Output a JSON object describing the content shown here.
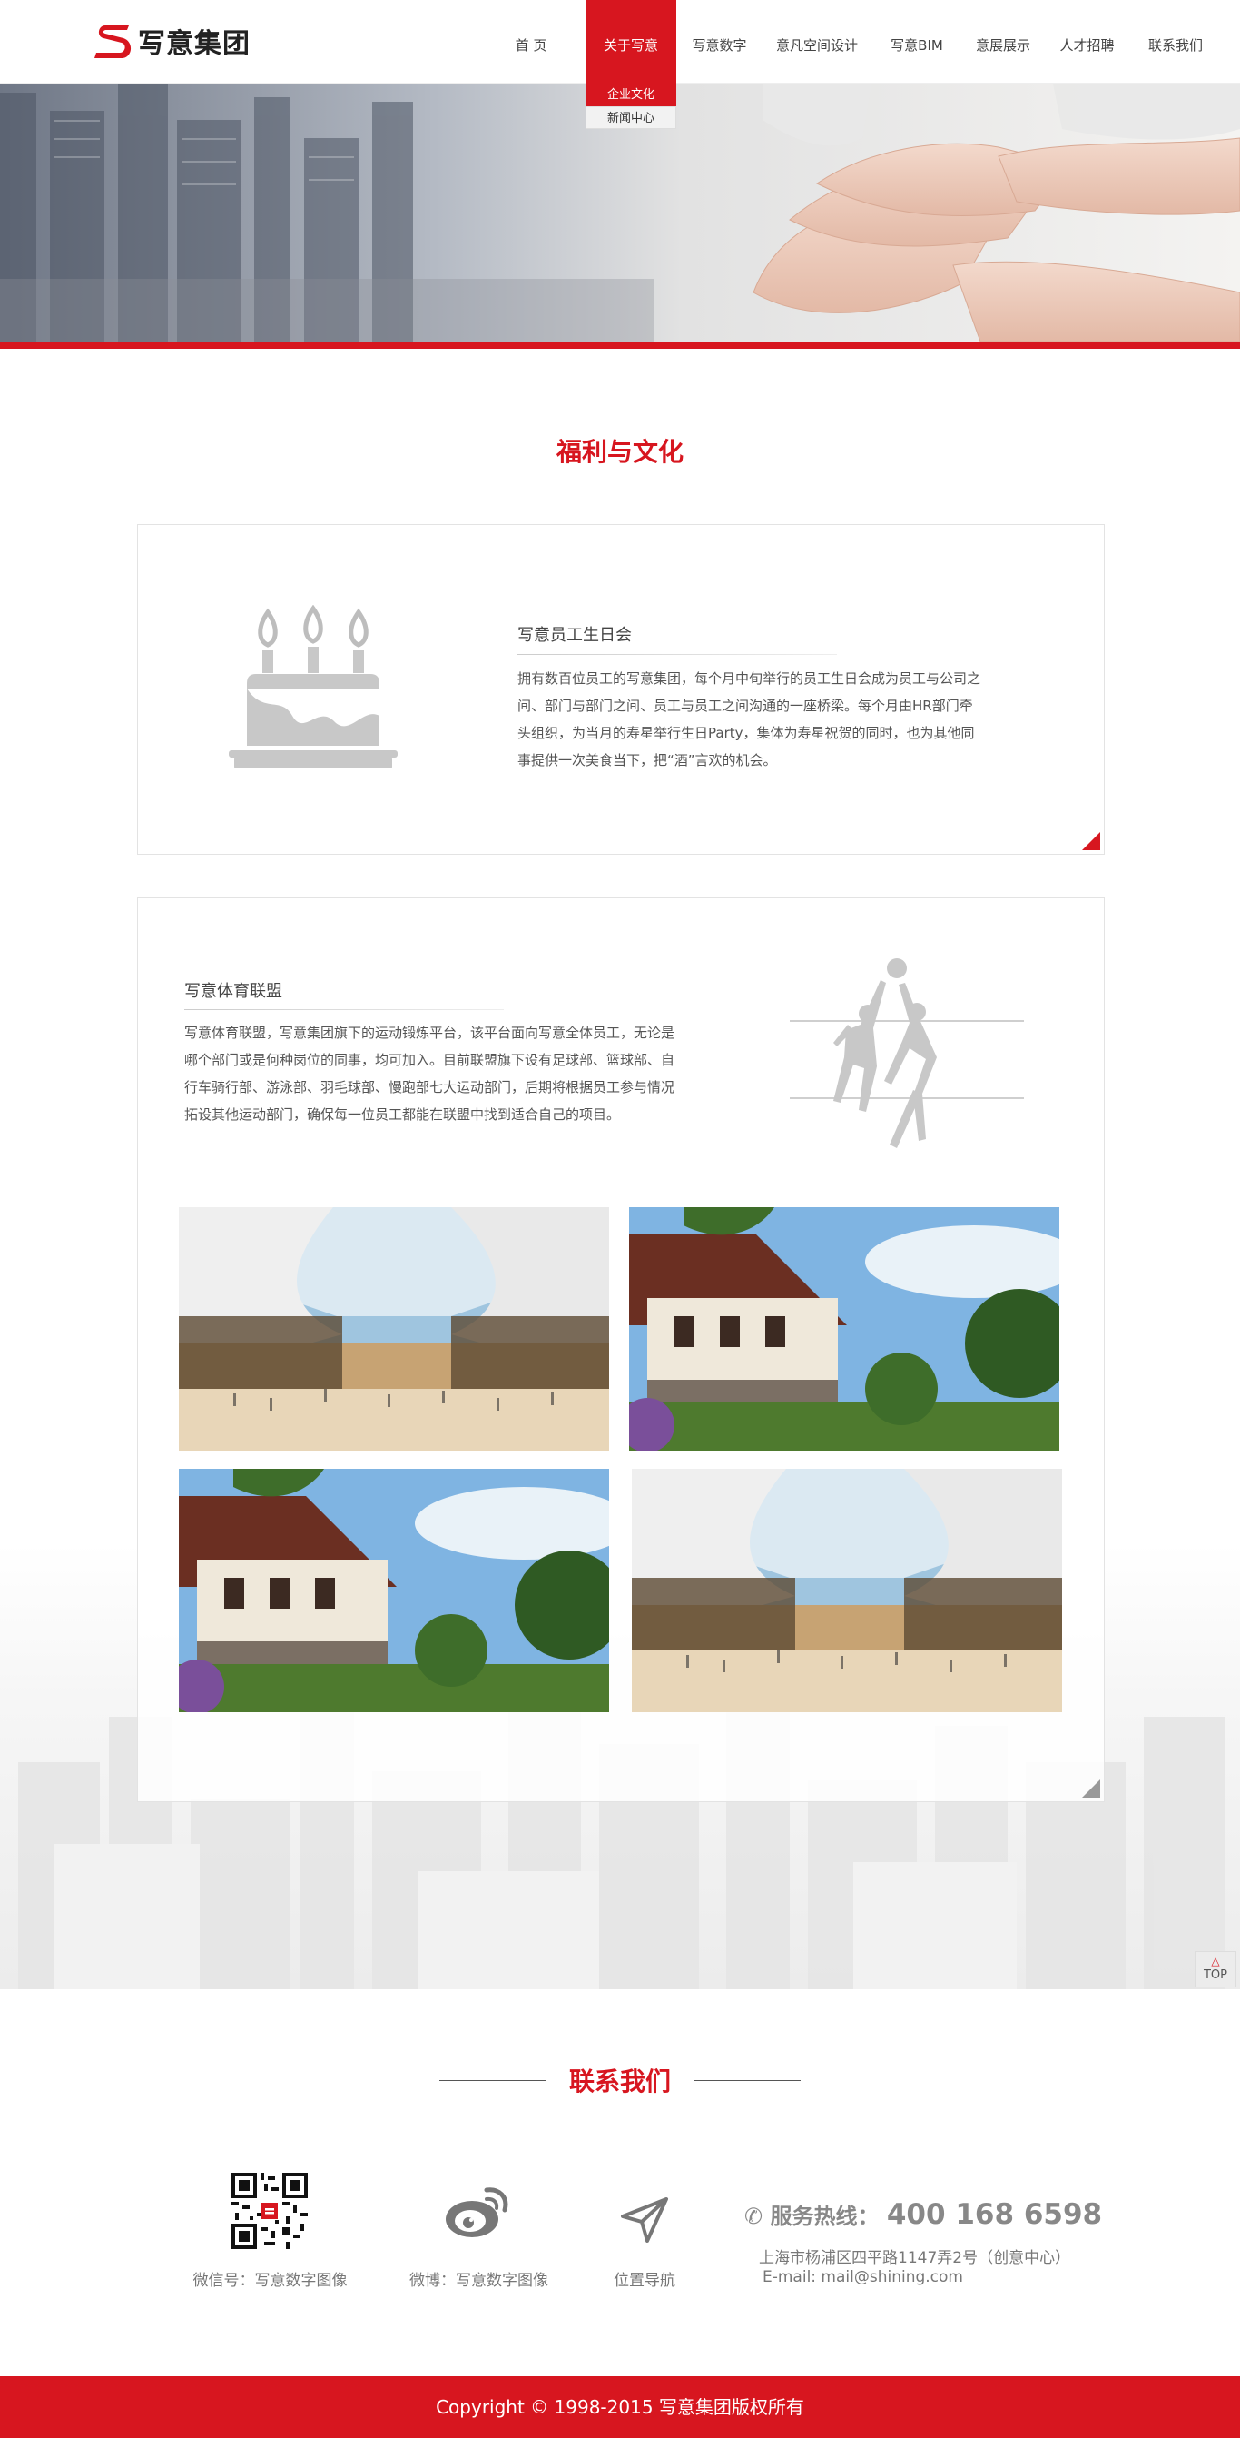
{
  "header": {
    "logo_text": "写意集团",
    "nav": [
      {
        "label": "首 页"
      },
      {
        "label": "关于写意"
      },
      {
        "label": "写意数字"
      },
      {
        "label": "意凡空间设计"
      },
      {
        "label": "写意BIM"
      },
      {
        "label": "意展展示"
      },
      {
        "label": "人才招聘"
      },
      {
        "label": "联系我们"
      }
    ],
    "submenu": [
      "企业文化",
      "新闻中心"
    ]
  },
  "colors": {
    "accent": "#d7161f",
    "text": "#555555",
    "icon_gray": "#c8c8c8"
  },
  "section1": {
    "title": "福利与文化"
  },
  "birthday": {
    "icon": "birthday-cake-icon",
    "heading": "写意员工生日会",
    "lines": [
      "拥有数百位员工的写意集团，每个月中旬举行的员工生日会成为员工与公司之",
      "间、部门与部门之间、员工与员工之间沟通的一座桥梁。每个月由HR部门牵",
      "头组织，为当月的寿星举行生日Party，集体为寿星祝贺的同时，也为其他同",
      "事提供一次美食当下，把“酒”言欢的机会。"
    ]
  },
  "sports": {
    "icon": "volleyball-players-icon",
    "heading": "写意体育联盟",
    "lines": [
      "写意体育联盟，写意集团旗下的运动锻炼平台，该平台面向写意全体员工，无论是",
      "哪个部门或是何种岗位的同事，均可加入。目前联盟旗下设有足球部、篮球部、自",
      "行车骑行部、游泳部、羽毛球部、慢跑部七大运动部门，后期将根据员工参与情况",
      "拓设其他运动部门，确保每一位员工都能在联盟中找到适合自己的项目。"
    ]
  },
  "top_button": {
    "label": "TOP"
  },
  "contact": {
    "title": "联系我们",
    "wechat_label": "微信号：写意数字图像",
    "weibo_label": "微博：写意数字图像",
    "nav_label": "位置导航",
    "hotline_label": "服务热线：",
    "hotline_number": "400 168 6598",
    "address": "上海市杨浦区四平路1147弄2号（创意中心）",
    "email": "E-mail: mail@shining.com"
  },
  "footer": {
    "copyright": "Copyright © 1998-2015 写意集团版权所有"
  }
}
